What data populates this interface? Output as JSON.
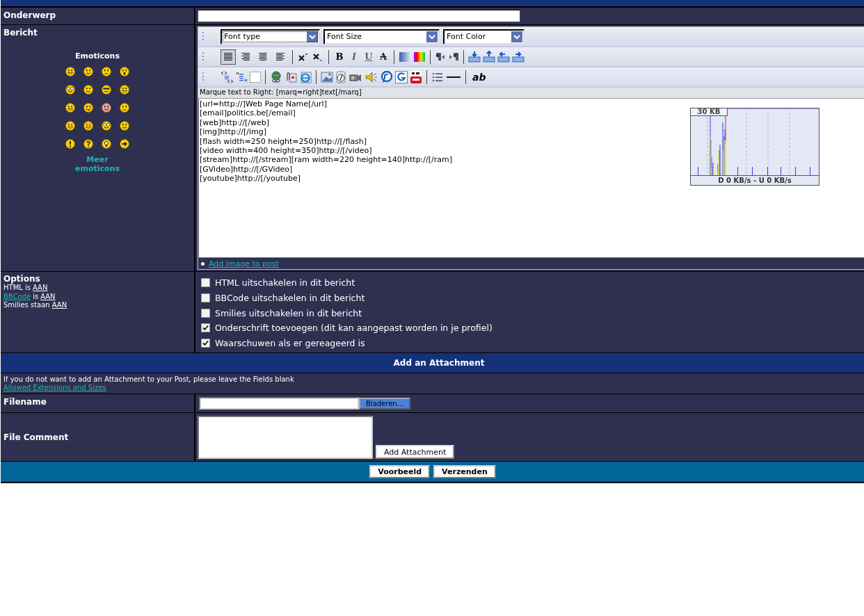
{
  "subject": {
    "label": "Onderwerp"
  },
  "message": {
    "label": "Bericht",
    "emoticons": {
      "title": "Emoticons",
      "more_link": "Meer emoticons"
    },
    "font_selects": [
      "Font type",
      "Font Size",
      "Font Color"
    ],
    "align_buttons": [
      {
        "selected": true
      },
      {
        "selected": false
      },
      {
        "selected": false
      },
      {
        "selected": false
      }
    ],
    "format_buttons": [
      "B",
      "I",
      "U",
      "A"
    ],
    "spell_button": "ab",
    "hint": "Marque text to Right: [marq=right]text[/marq]",
    "lines": [
      "[url=http://]Web Page Name[/url]",
      "[email]politics.be[/email]",
      "[web]http://[/web]",
      "[img]http://[/img]",
      "[flash width=250 height=250]http://[/flash]",
      "[video width=400 height=350]http://[/video]",
      "[stream]http://[/stream][ram width=220 height=140]http://[/ram]",
      "[GVideo]http://[/GVideo]",
      "[youtube]http://[/youtube]"
    ],
    "add_image_link": "Add image to post"
  },
  "net_monitor": {
    "scale": "30 KB",
    "reading": "D 0 KB/s - U 0 KB/s"
  },
  "options": {
    "title": "Options",
    "status": [
      {
        "prefix": "HTML is",
        "value": "AAN"
      },
      {
        "link": "BBCode",
        "prefix": "is",
        "value": "AAN"
      },
      {
        "prefix": "Smilies staan",
        "value": "AAN"
      }
    ],
    "checkboxes": [
      {
        "label": "HTML uitschakelen in dit bericht",
        "checked": false
      },
      {
        "label": "BBCode uitschakelen in dit bericht",
        "checked": false
      },
      {
        "label": "Smilies uitschakelen in dit bericht",
        "checked": false
      },
      {
        "label": "Onderschrift toevoegen (dit kan aangepast worden in je profiel)",
        "checked": true
      },
      {
        "label": "Waarschuwen als er gereageerd is",
        "checked": true
      }
    ]
  },
  "attachment": {
    "title": "Add an Attachment",
    "note": "If you do not want to add an Attachment to your Post, please leave the Fields blank",
    "link": "Allowed Extensions and Sizes",
    "filename_label": "Filename",
    "browse_button": "Bladeren...",
    "comment_label": "File Comment",
    "add_button": "Add Attachment"
  },
  "buttons": [
    "Voorbeeld",
    "Verzenden"
  ]
}
